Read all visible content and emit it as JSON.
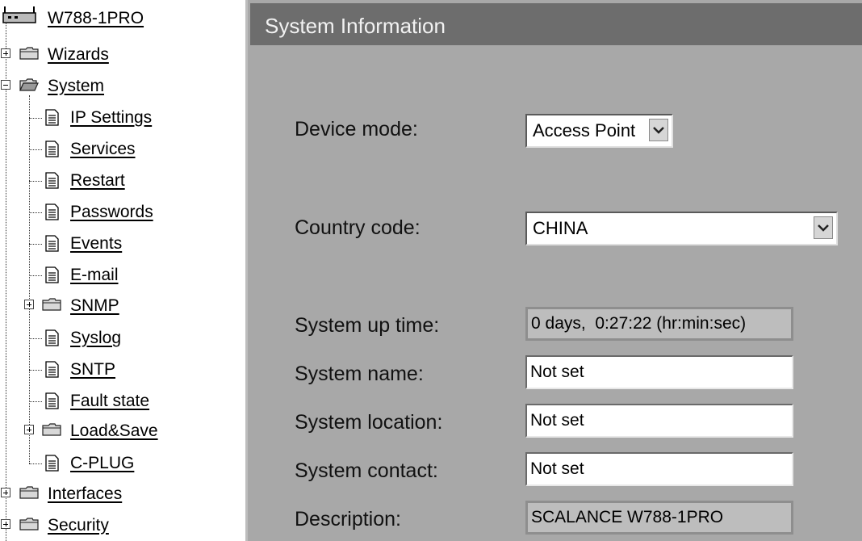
{
  "tree": {
    "root": {
      "label": "W788-1PRO",
      "icon": "device-icon"
    },
    "items": [
      {
        "label": "Wizards",
        "type": "folder",
        "expander": "plus"
      },
      {
        "label": "System",
        "type": "folder",
        "expander": "minus",
        "open": true
      },
      {
        "label": "IP Settings",
        "type": "page"
      },
      {
        "label": "Services",
        "type": "page"
      },
      {
        "label": "Restart",
        "type": "page"
      },
      {
        "label": "Passwords",
        "type": "page"
      },
      {
        "label": "Events",
        "type": "page"
      },
      {
        "label": "E-mail",
        "type": "page"
      },
      {
        "label": "SNMP",
        "type": "folder",
        "expander": "plus"
      },
      {
        "label": "Syslog",
        "type": "page"
      },
      {
        "label": "SNTP",
        "type": "page"
      },
      {
        "label": "Fault state",
        "type": "page"
      },
      {
        "label": "Load&Save",
        "type": "folder",
        "expander": "plus"
      },
      {
        "label": "C-PLUG",
        "type": "page"
      },
      {
        "label": "Interfaces",
        "type": "folder",
        "expander": "plus"
      },
      {
        "label": "Security",
        "type": "folder",
        "expander": "plus"
      }
    ]
  },
  "panel": {
    "title": "System Information",
    "device_mode": {
      "label": "Device mode:",
      "value": "Access Point"
    },
    "country_code": {
      "label": "Country code:",
      "value": "CHINA"
    },
    "up_time": {
      "label": "System up time:",
      "value": "0 days,  0:27:22 (hr:min:sec)"
    },
    "system_name": {
      "label": "System name:",
      "value": "Not set"
    },
    "system_location": {
      "label": "System location:",
      "value": "Not set"
    },
    "system_contact": {
      "label": "System contact:",
      "value": "Not set"
    },
    "description": {
      "label": "Description:",
      "value": "SCALANCE W788-1PRO"
    }
  },
  "colors": {
    "panel_bg": "#a8a8a8",
    "header_bg": "#6d6d6d",
    "header_text": "#f2f2f2",
    "readonly_bg": "#bdbdbd"
  }
}
